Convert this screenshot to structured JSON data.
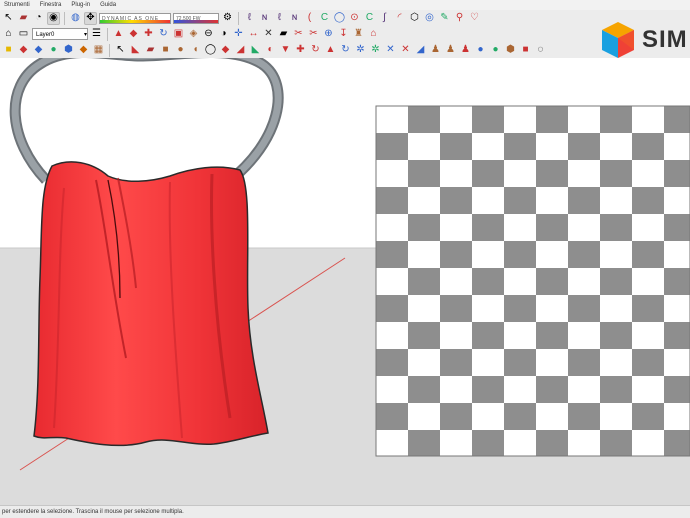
{
  "menu": [
    "Strumenti",
    "Finestra",
    "Plug-in",
    "Guida"
  ],
  "layer_selector": {
    "value": "Layer0"
  },
  "style_slider": {
    "label": "DYNAMIC AS ONE",
    "value_text": "0.00"
  },
  "gradient_slider": {
    "label": "72.500 FW"
  },
  "brand": {
    "text": "SIM"
  },
  "status": {
    "hint": "per estendere la selezione. Trascina il mouse per selezione multipla."
  },
  "colors": {
    "cloth": "#f2343a",
    "ring": "#8c9297",
    "checker_dark": "#8e8e8e",
    "checker_light": "#ffffff",
    "ground": "#dcdcdc",
    "sky": "#ffffff",
    "axis_red": "#d9534f"
  },
  "icons": {
    "row1": [
      "select-arrow-icon",
      "eraser-icon",
      "paint-bucket-icon",
      "camera-icon",
      "orbit-icon",
      "pan-icon",
      "sketch-curve-icon",
      "sketch-curve-icon",
      "arc-icon",
      "circle-icon",
      "polygon-icon",
      "freehand-icon",
      "zoom-icon",
      "wrench-icon",
      "heart-icon"
    ],
    "row2": [
      "house-icon",
      "new-file-icon",
      "folder-icon",
      "save-icon",
      "cut-icon",
      "copy-icon",
      "paste-icon",
      "erase-icon",
      "undo-icon",
      "redo-icon",
      "print-icon",
      "model-info-icon",
      "pushpull-icon",
      "follow-me-icon",
      "move-icon",
      "rotate-icon",
      "scale-icon",
      "offset-icon",
      "tape-icon",
      "protractor-icon",
      "axes-icon",
      "dimension-icon",
      "text-icon",
      "3d-text-icon",
      "section-icon",
      "paint-icon",
      "search-icon"
    ],
    "row3": [
      "rectangle-icon",
      "line-icon",
      "arc-tool-icon",
      "circle-tool-icon",
      "polygon-tool-icon",
      "freehand-tool-icon",
      "select-icon",
      "component-icon",
      "paint-tool-icon",
      "erase-tool-icon",
      "push-icon",
      "move-tool-icon",
      "rotate-tool-icon",
      "scale-tool-icon",
      "offset-tool-icon",
      "tape-tool-icon",
      "dims-icon",
      "protractor-tool-icon",
      "text-tool-icon",
      "axes-tool-icon",
      "3dtext-tool-icon",
      "orbit-tool-icon",
      "pan-tool-icon",
      "zoom-tool-icon",
      "zoom-window-icon",
      "zoom-extents-icon",
      "previous-icon",
      "next-icon",
      "walk-icon",
      "look-icon",
      "position-camera-icon",
      "section-tool-icon",
      "google-earth-icon",
      "warehouse-icon",
      "extension-icon",
      "layout-icon",
      "style-icon"
    ]
  }
}
